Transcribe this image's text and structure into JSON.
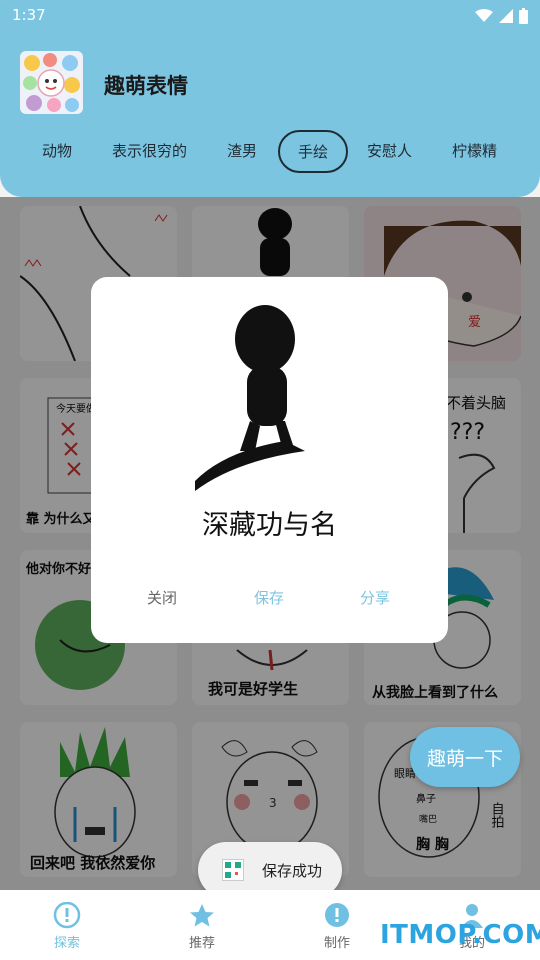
{
  "status_bar": {
    "time": "1:37"
  },
  "header": {
    "title": "趣萌表情"
  },
  "tabs": [
    {
      "label": "动物"
    },
    {
      "label": "表示很穷的"
    },
    {
      "label": "渣男"
    },
    {
      "label": "手绘",
      "active": true
    },
    {
      "label": "安慰人"
    },
    {
      "label": "柠檬精"
    }
  ],
  "cards": [
    {
      "caption": ""
    },
    {
      "caption": ""
    },
    {
      "caption": ""
    },
    {
      "caption": "靠 为什么又",
      "top_text": "今天要做"
    },
    {
      "caption": ""
    },
    {
      "caption": "",
      "top_text": "不着头脑",
      "extra": "???"
    },
    {
      "caption": "",
      "top_text": "他对你不好"
    },
    {
      "caption": "我可是好学生"
    },
    {
      "caption": "从我脸上看到了什么"
    },
    {
      "caption": "回来吧 我依然爱你"
    },
    {
      "caption": "",
      "face_mark": "3"
    },
    {
      "caption": "胸 胸",
      "labels": [
        "眼睛",
        "鼻子",
        "嘴巴",
        "自拍"
      ]
    }
  ],
  "dialog": {
    "title": "深藏功与名",
    "close_label": "关闭",
    "save_label": "保存",
    "share_label": "分享"
  },
  "fab": {
    "label": "趣萌一下"
  },
  "toast": {
    "text": "保存成功"
  },
  "bottom_nav": [
    {
      "label": "探索",
      "icon": "info-icon",
      "active": true
    },
    {
      "label": "推荐",
      "icon": "star-icon"
    },
    {
      "label": "制作",
      "icon": "info-icon"
    },
    {
      "label": "我的",
      "icon": "person-icon"
    }
  ],
  "watermark": "ITMOP.COM",
  "colors": {
    "accent": "#7cc5e1",
    "scrim": "rgba(0,0,0,0.42)"
  }
}
